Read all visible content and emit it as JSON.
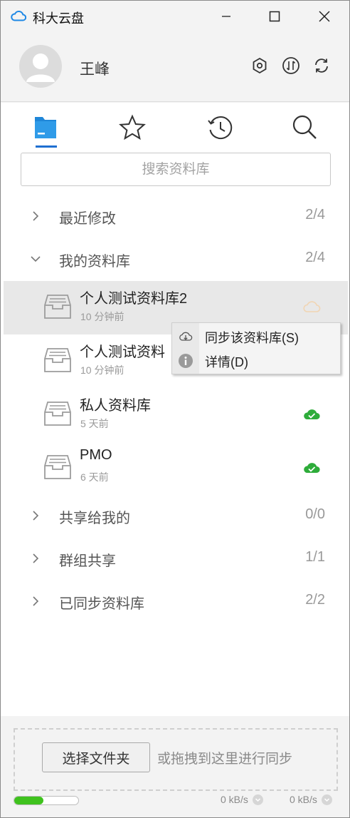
{
  "window": {
    "title": "科大云盘"
  },
  "user": {
    "name": "王峰"
  },
  "search": {
    "placeholder": "搜索资料库"
  },
  "categories": [
    {
      "label": "最近修改",
      "count": "2/4",
      "expanded": false
    },
    {
      "label": "我的资料库",
      "count": "2/4",
      "expanded": true
    },
    {
      "label": "共享给我的",
      "count": "0/0",
      "expanded": false
    },
    {
      "label": "群组共享",
      "count": "1/1",
      "expanded": false
    },
    {
      "label": "已同步资料库",
      "count": "2/2",
      "expanded": false
    }
  ],
  "libraries": [
    {
      "name": "个人测试资料库2",
      "time": "10 分钟前",
      "status": "unsynced"
    },
    {
      "name": "个人测试资料",
      "time": "10 分钟前",
      "status": "hidden"
    },
    {
      "name": "私人资料库",
      "time": "5 天前",
      "status": "synced"
    },
    {
      "name": "PMO",
      "time": "6 天前",
      "status": "synced"
    }
  ],
  "context_menu": {
    "items": [
      {
        "label": "同步该资料库(S)",
        "icon": "sync-download-icon"
      },
      {
        "label": "详情(D)",
        "icon": "info-icon"
      }
    ]
  },
  "footer": {
    "choose_label": "选择文件夹",
    "drop_hint": "或拖拽到这里进行同步",
    "upload_rate": "0 kB/s",
    "download_rate": "0 kB/s",
    "progress": 0.45
  },
  "colors": {
    "accent": "#1f6fd1",
    "synced": "#2eac3a",
    "unsynced": "#f1d5b3",
    "progress": "#3fc21e"
  }
}
